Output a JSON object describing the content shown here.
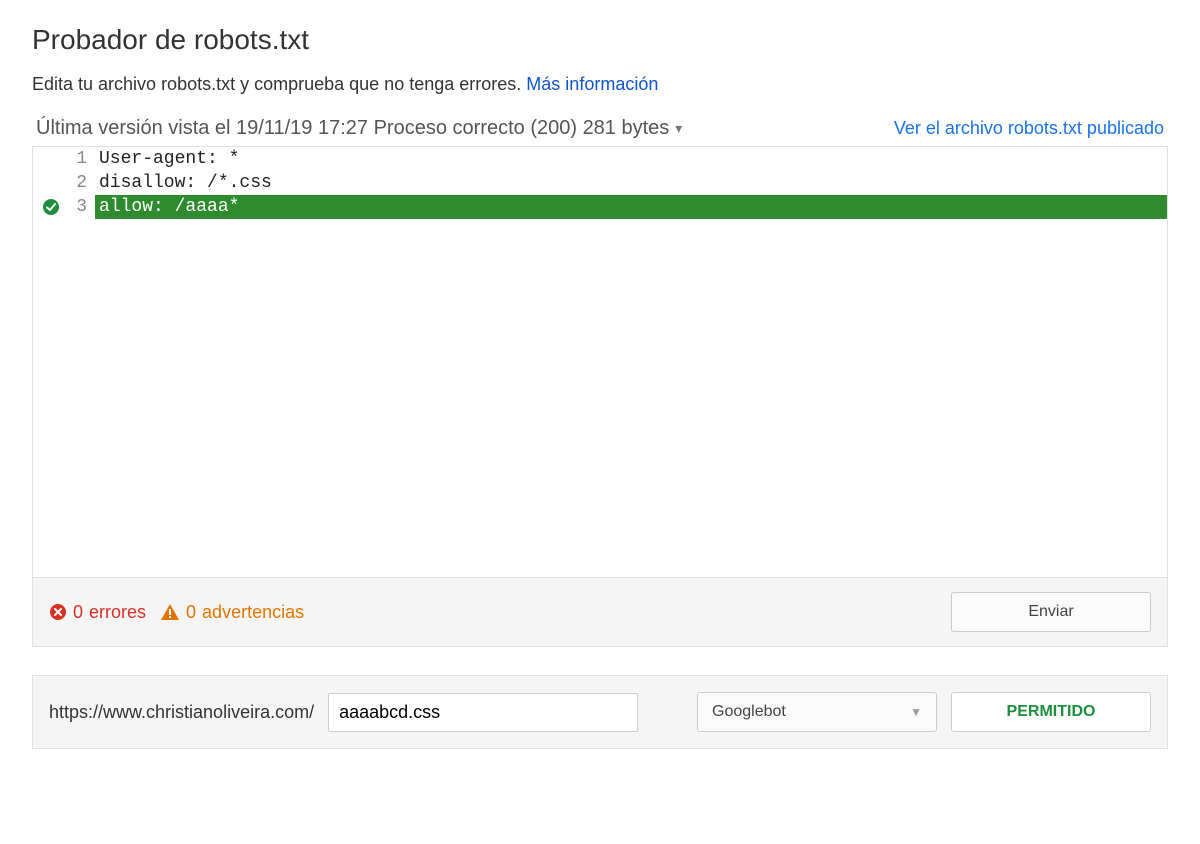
{
  "page": {
    "title": "Probador de robots.txt",
    "subtitle": "Edita tu archivo robots.txt y comprueba que no tenga errores.",
    "more_info": "Más información"
  },
  "status": {
    "text": "Última versión vista el 19/11/19 17:27 Proceso correcto (200) 281 bytes",
    "view_published": "Ver el archivo robots.txt publicado"
  },
  "editor": {
    "lines": [
      {
        "num": "1",
        "code": "User-agent: *",
        "highlight": false,
        "check": false
      },
      {
        "num": "2",
        "code": "disallow: /*.css",
        "highlight": false,
        "check": false
      },
      {
        "num": "3",
        "code": "allow: /aaaa*",
        "highlight": true,
        "check": true
      }
    ]
  },
  "footer": {
    "errors_count": "0",
    "errors_label": "errores",
    "warnings_count": "0",
    "warnings_label": "advertencias",
    "submit_label": "Enviar"
  },
  "tester": {
    "url_prefix": "https://www.christianoliveira.com/",
    "url_value": "aaaabcd.css",
    "bot_selected": "Googlebot",
    "result_label": "PERMITIDO"
  }
}
